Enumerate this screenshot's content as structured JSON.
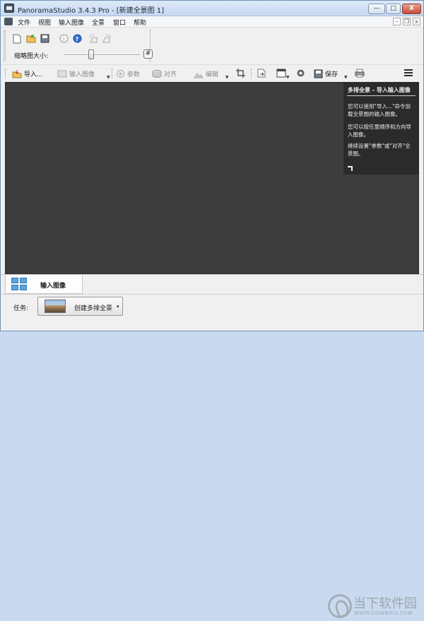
{
  "window": {
    "title": "PanoramaStudio 3.4.3 Pro - [新建全景图 1]",
    "min_glyph": "—",
    "max_glyph": "□",
    "close_glyph": "X"
  },
  "menubar": {
    "items": [
      "文件",
      "视图",
      "输入图像",
      "全景",
      "窗口",
      "帮助"
    ],
    "mdi_min": "–",
    "mdi_restore": "❐",
    "mdi_close": "x"
  },
  "toolbar": {
    "thumb_size_label": "缩略图大小:",
    "thumb_size_value": 0.36,
    "hash_glyph": "#"
  },
  "actions": {
    "import": "导入...",
    "input_image": "输入图像",
    "params": "参数",
    "align": "对齐",
    "edit": "编辑",
    "save": "保存"
  },
  "help": {
    "title": "多排全景 - 导入输入图像",
    "p1": "您可以使用\"导入...\"命令加载全景图的输入图像。",
    "p2": "您可以按任意顺序和方向导入图像。",
    "p3": "继续设置\"参数\"或\"对齐\"全景图。"
  },
  "tabs": {
    "active_label": "输入图像"
  },
  "task": {
    "label": "任务:",
    "value": "创建多排全景",
    "arrow": "▾"
  },
  "watermark": {
    "text": "当下软件园",
    "sub": "WWW.DOWNXIA.COM"
  },
  "colors": {
    "canvas": "#3d3d3d",
    "help_panel": "#2b2b2b",
    "titlebar": "#c6d9f0",
    "close_button": "#c84b36"
  }
}
